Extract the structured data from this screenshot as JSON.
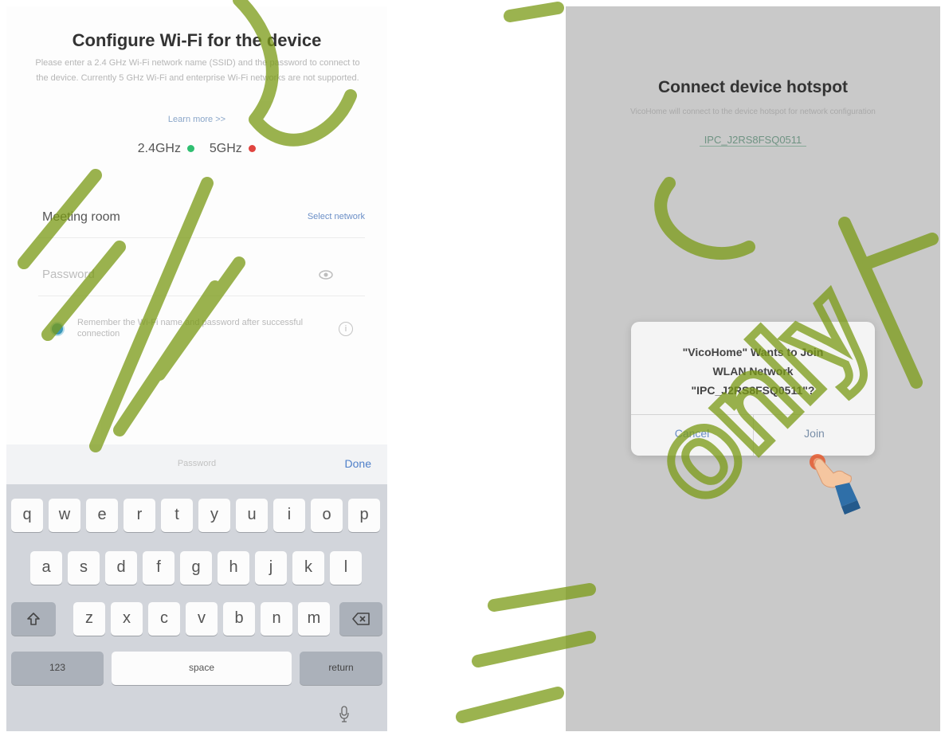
{
  "left_screen": {
    "title": "Configure Wi-Fi for the device",
    "description": "Please enter a 2.4 GHz Wi-Fi network name (SSID) and the password to connect to the device. Currently 5 GHz Wi-Fi and enterprise Wi-Fi networks are not supported.",
    "learn_more": "Learn more >>",
    "band_24": "2.4GHz",
    "band_5": "5GHz",
    "band_24_color": "#2fbf71",
    "band_5_color": "#e0443f",
    "network_name": "Meeting room",
    "select_network": "Select network",
    "password_placeholder": "Password",
    "remember_text": "Remember the Wi-Fi name and password after successful connection",
    "info_glyph": "i",
    "keyboard": {
      "field_label": "Password",
      "done_label": "Done",
      "row1": [
        "q",
        "w",
        "e",
        "r",
        "t",
        "y",
        "u",
        "i",
        "o",
        "p"
      ],
      "row2": [
        "a",
        "s",
        "d",
        "f",
        "g",
        "h",
        "j",
        "k",
        "l"
      ],
      "row3": [
        "z",
        "x",
        "c",
        "v",
        "b",
        "n",
        "m"
      ],
      "numbers_label": "123",
      "space_label": "space",
      "return_label": "return"
    }
  },
  "right_screen": {
    "title": "Connect device hotspot",
    "description": "VicoHome will connect to the device hotspot for network configuration",
    "ssid": "IPC_J2RS8FSQ0511",
    "alert": {
      "message_line1": "\"VicoHome\" Wants to Join",
      "message_line2": "WLAN Network",
      "message_line3": "\"IPC_J2RS8FSQ0511\"?",
      "cancel_label": "Cancel",
      "join_label": "Join"
    }
  },
  "watermark_text": "only",
  "accent_color": "#4e7fc9",
  "watermark_color": "#7a9a14"
}
